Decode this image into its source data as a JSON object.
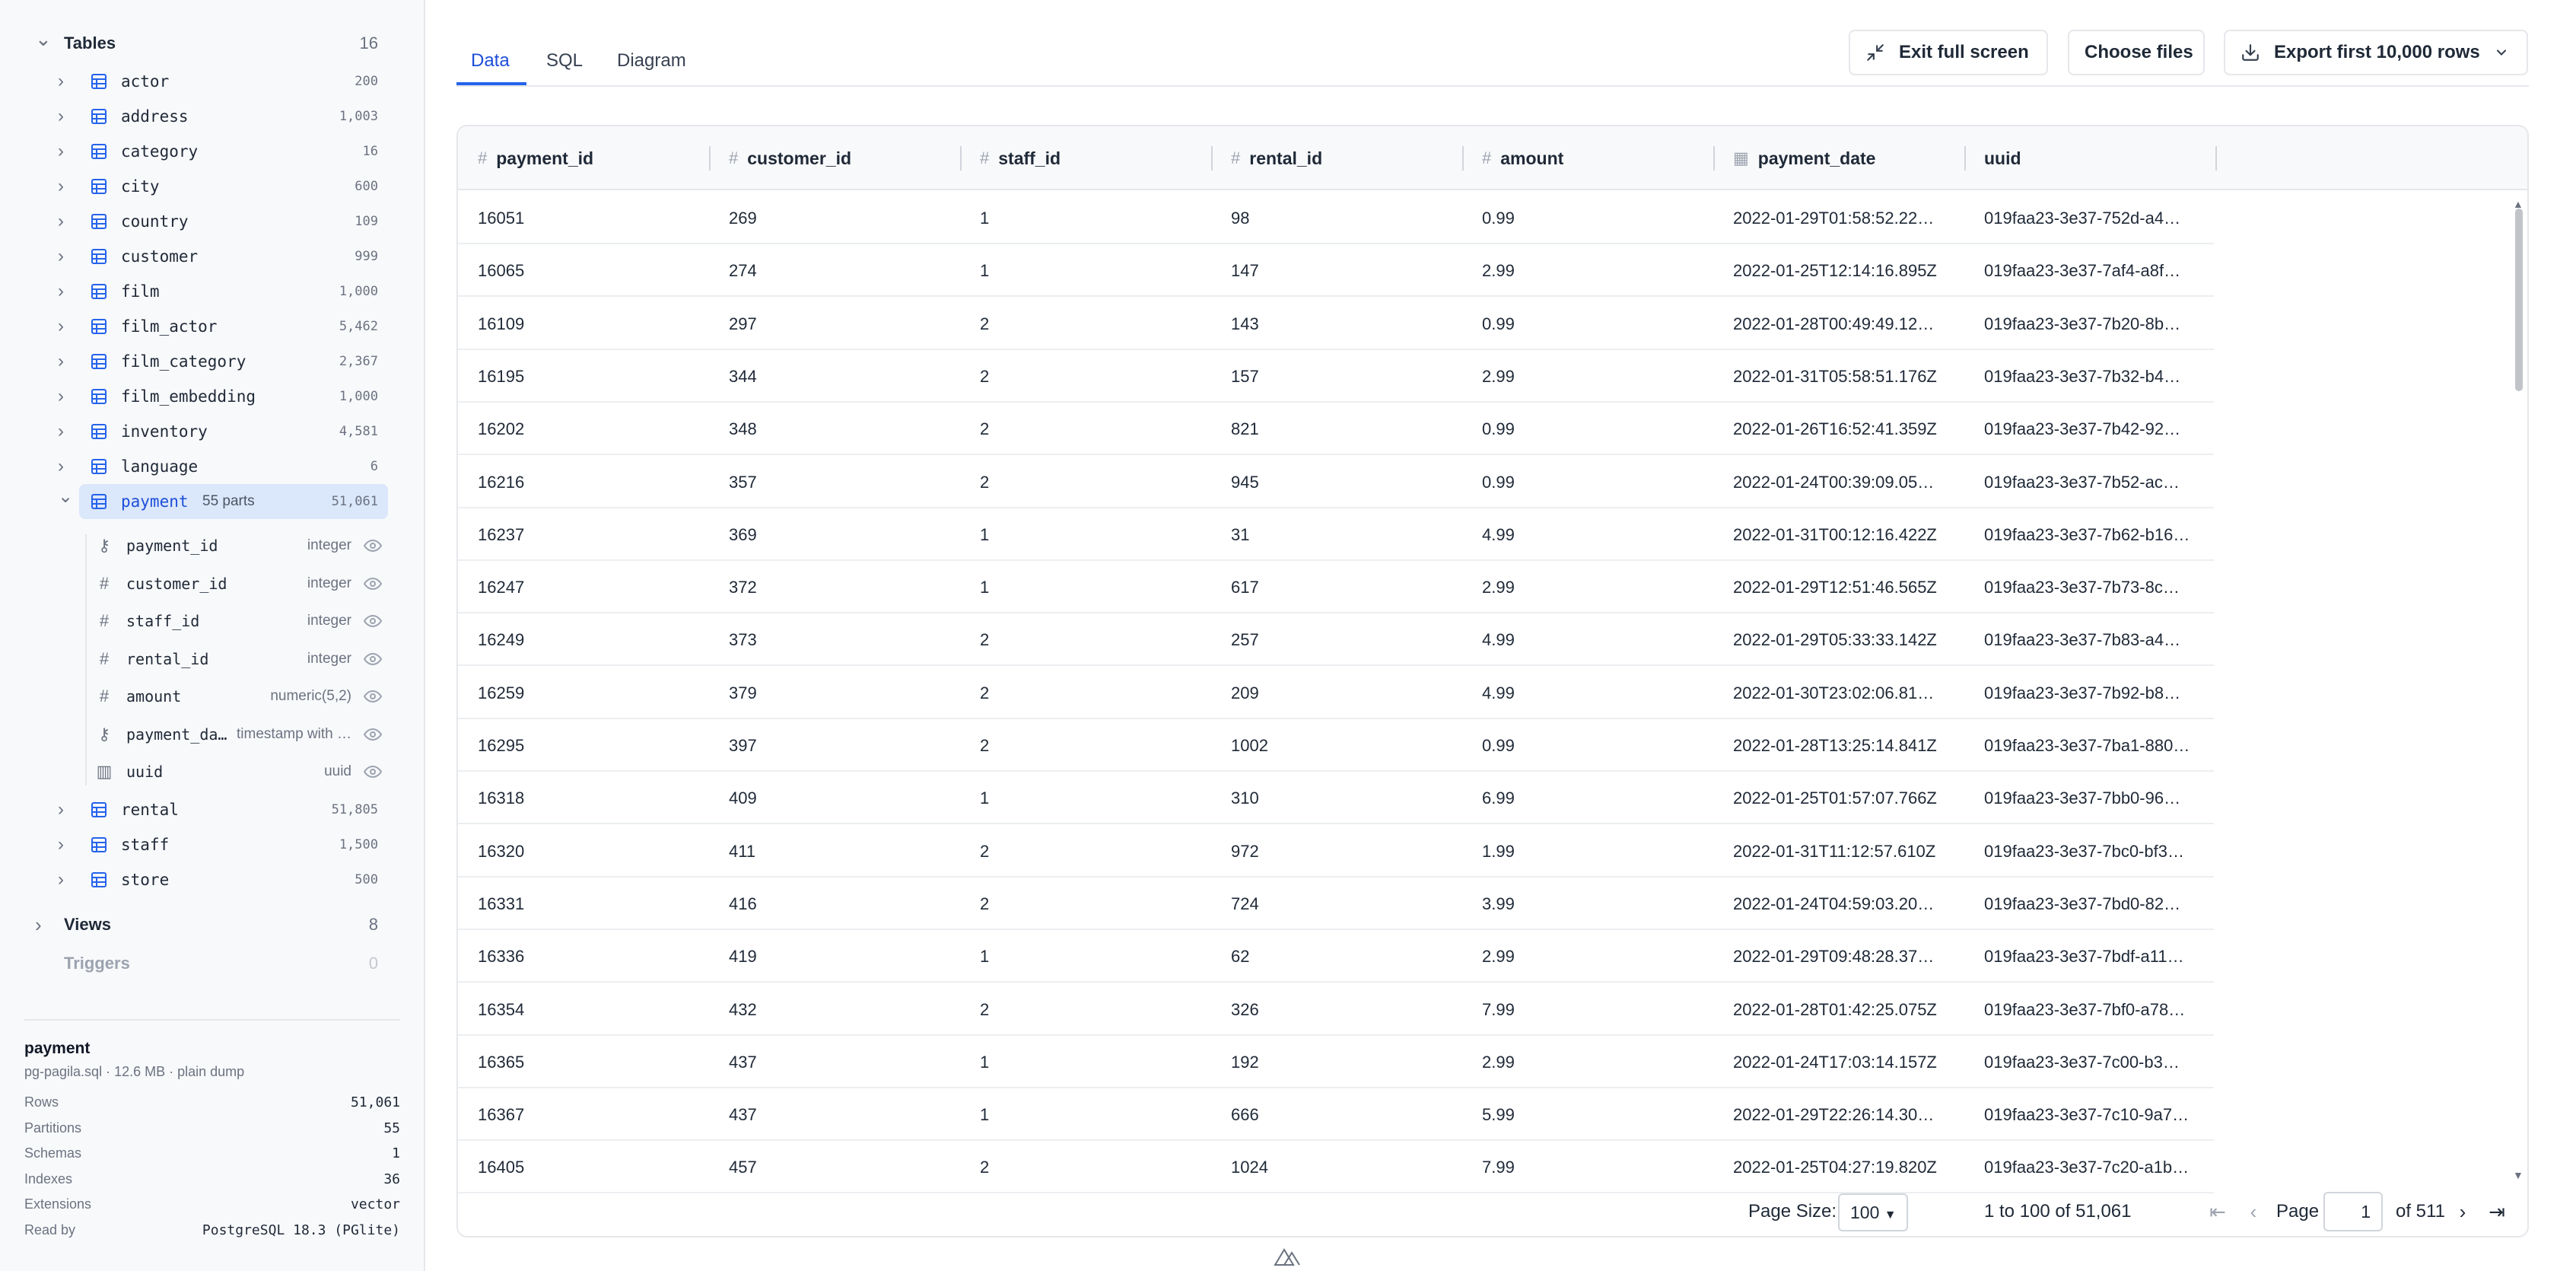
{
  "sidebar": {
    "tables_section": {
      "label": "Tables",
      "count": "16"
    },
    "tables": [
      {
        "name": "actor",
        "count": "200"
      },
      {
        "name": "address",
        "count": "1,003"
      },
      {
        "name": "category",
        "count": "16"
      },
      {
        "name": "city",
        "count": "600"
      },
      {
        "name": "country",
        "count": "109"
      },
      {
        "name": "customer",
        "count": "999"
      },
      {
        "name": "film",
        "count": "1,000"
      },
      {
        "name": "film_actor",
        "count": "5,462"
      },
      {
        "name": "film_category",
        "count": "2,367"
      },
      {
        "name": "film_embedding",
        "count": "1,000"
      },
      {
        "name": "inventory",
        "count": "4,581"
      },
      {
        "name": "language",
        "count": "6"
      },
      {
        "name": "payment",
        "count": "51,061",
        "parts": "55 parts",
        "expanded": true
      },
      {
        "name": "rental",
        "count": "51,805"
      },
      {
        "name": "staff",
        "count": "1,500"
      },
      {
        "name": "store",
        "count": "500"
      }
    ],
    "payment_columns": [
      {
        "name": "payment_id",
        "type": "integer",
        "icon": "key-icon"
      },
      {
        "name": "customer_id",
        "type": "integer",
        "icon": "hash-icon"
      },
      {
        "name": "staff_id",
        "type": "integer",
        "icon": "hash-icon"
      },
      {
        "name": "rental_id",
        "type": "integer",
        "icon": "hash-icon"
      },
      {
        "name": "amount",
        "type": "numeric(5,2)",
        "icon": "hash-icon"
      },
      {
        "name": "payment_da…",
        "type": "timestamp with …",
        "icon": "key-icon"
      },
      {
        "name": "uuid",
        "type": "uuid",
        "icon": "columns-icon"
      }
    ],
    "views_section": {
      "label": "Views",
      "count": "8"
    },
    "triggers_section": {
      "label": "Triggers",
      "count": "0"
    },
    "info": {
      "title": "payment",
      "subtitle": "pg-pagila.sql · 12.6 MB · plain dump",
      "rows": [
        {
          "label": "Rows",
          "value": "51,061"
        },
        {
          "label": "Partitions",
          "value": "55"
        },
        {
          "label": "Schemas",
          "value": "1"
        },
        {
          "label": "Indexes",
          "value": "36"
        },
        {
          "label": "Extensions",
          "value": "vector"
        },
        {
          "label": "Read by",
          "value": "PostgreSQL 18.3 (PGlite)"
        }
      ]
    }
  },
  "tabs": [
    {
      "label": "Data",
      "active": true
    },
    {
      "label": "SQL",
      "active": false
    },
    {
      "label": "Diagram",
      "active": false
    }
  ],
  "toolbar": {
    "exit_full_screen": "Exit full screen",
    "choose_files": "Choose files",
    "export": "Export first 10,000 rows"
  },
  "grid": {
    "columns": [
      {
        "label": "payment_id",
        "icon": "hash-icon"
      },
      {
        "label": "customer_id",
        "icon": "hash-icon"
      },
      {
        "label": "staff_id",
        "icon": "hash-icon"
      },
      {
        "label": "rental_id",
        "icon": "hash-icon"
      },
      {
        "label": "amount",
        "icon": "hash-icon"
      },
      {
        "label": "payment_date",
        "icon": "calendar-icon"
      },
      {
        "label": "uuid",
        "icon": ""
      }
    ],
    "rows": [
      [
        "16051",
        "269",
        "1",
        "98",
        "0.99",
        "2022-01-29T01:58:52.22…",
        "019faa23-3e37-752d-a4…"
      ],
      [
        "16065",
        "274",
        "1",
        "147",
        "2.99",
        "2022-01-25T12:14:16.895Z",
        "019faa23-3e37-7af4-a8f…"
      ],
      [
        "16109",
        "297",
        "2",
        "143",
        "0.99",
        "2022-01-28T00:49:49.12…",
        "019faa23-3e37-7b20-8b…"
      ],
      [
        "16195",
        "344",
        "2",
        "157",
        "2.99",
        "2022-01-31T05:58:51.176Z",
        "019faa23-3e37-7b32-b4…"
      ],
      [
        "16202",
        "348",
        "2",
        "821",
        "0.99",
        "2022-01-26T16:52:41.359Z",
        "019faa23-3e37-7b42-92…"
      ],
      [
        "16216",
        "357",
        "2",
        "945",
        "0.99",
        "2022-01-24T00:39:09.05…",
        "019faa23-3e37-7b52-ac…"
      ],
      [
        "16237",
        "369",
        "1",
        "31",
        "4.99",
        "2022-01-31T00:12:16.422Z",
        "019faa23-3e37-7b62-b16…"
      ],
      [
        "16247",
        "372",
        "1",
        "617",
        "2.99",
        "2022-01-29T12:51:46.565Z",
        "019faa23-3e37-7b73-8c…"
      ],
      [
        "16249",
        "373",
        "2",
        "257",
        "4.99",
        "2022-01-29T05:33:33.142Z",
        "019faa23-3e37-7b83-a4…"
      ],
      [
        "16259",
        "379",
        "2",
        "209",
        "4.99",
        "2022-01-30T23:02:06.81…",
        "019faa23-3e37-7b92-b8…"
      ],
      [
        "16295",
        "397",
        "2",
        "1002",
        "0.99",
        "2022-01-28T13:25:14.841Z",
        "019faa23-3e37-7ba1-880…"
      ],
      [
        "16318",
        "409",
        "1",
        "310",
        "6.99",
        "2022-01-25T01:57:07.766Z",
        "019faa23-3e37-7bb0-96…"
      ],
      [
        "16320",
        "411",
        "2",
        "972",
        "1.99",
        "2022-01-31T11:12:57.610Z",
        "019faa23-3e37-7bc0-bf3…"
      ],
      [
        "16331",
        "416",
        "2",
        "724",
        "3.99",
        "2022-01-24T04:59:03.20…",
        "019faa23-3e37-7bd0-82…"
      ],
      [
        "16336",
        "419",
        "1",
        "62",
        "2.99",
        "2022-01-29T09:48:28.37…",
        "019faa23-3e37-7bdf-a11…"
      ],
      [
        "16354",
        "432",
        "2",
        "326",
        "7.99",
        "2022-01-28T01:42:25.075Z",
        "019faa23-3e37-7bf0-a78…"
      ],
      [
        "16365",
        "437",
        "1",
        "192",
        "2.99",
        "2022-01-24T17:03:14.157Z",
        "019faa23-3e37-7c00-b3…"
      ],
      [
        "16367",
        "437",
        "1",
        "666",
        "5.99",
        "2022-01-29T22:26:14.30…",
        "019faa23-3e37-7c10-9a7…"
      ],
      [
        "16405",
        "457",
        "2",
        "1024",
        "7.99",
        "2022-01-25T04:27:19.820Z",
        "019faa23-3e37-7c20-a1b…"
      ]
    ]
  },
  "pager": {
    "page_size_label": "Page Size:",
    "page_size_value": "100",
    "range_text": "1 to 100 of 51,061",
    "page_label": "Page",
    "page_value": "1",
    "of_text": "of 511"
  },
  "colors": {
    "accent": "#2563eb",
    "selected_bg": "#dbe7fb",
    "sidebar_bg": "#f8f9fb"
  }
}
